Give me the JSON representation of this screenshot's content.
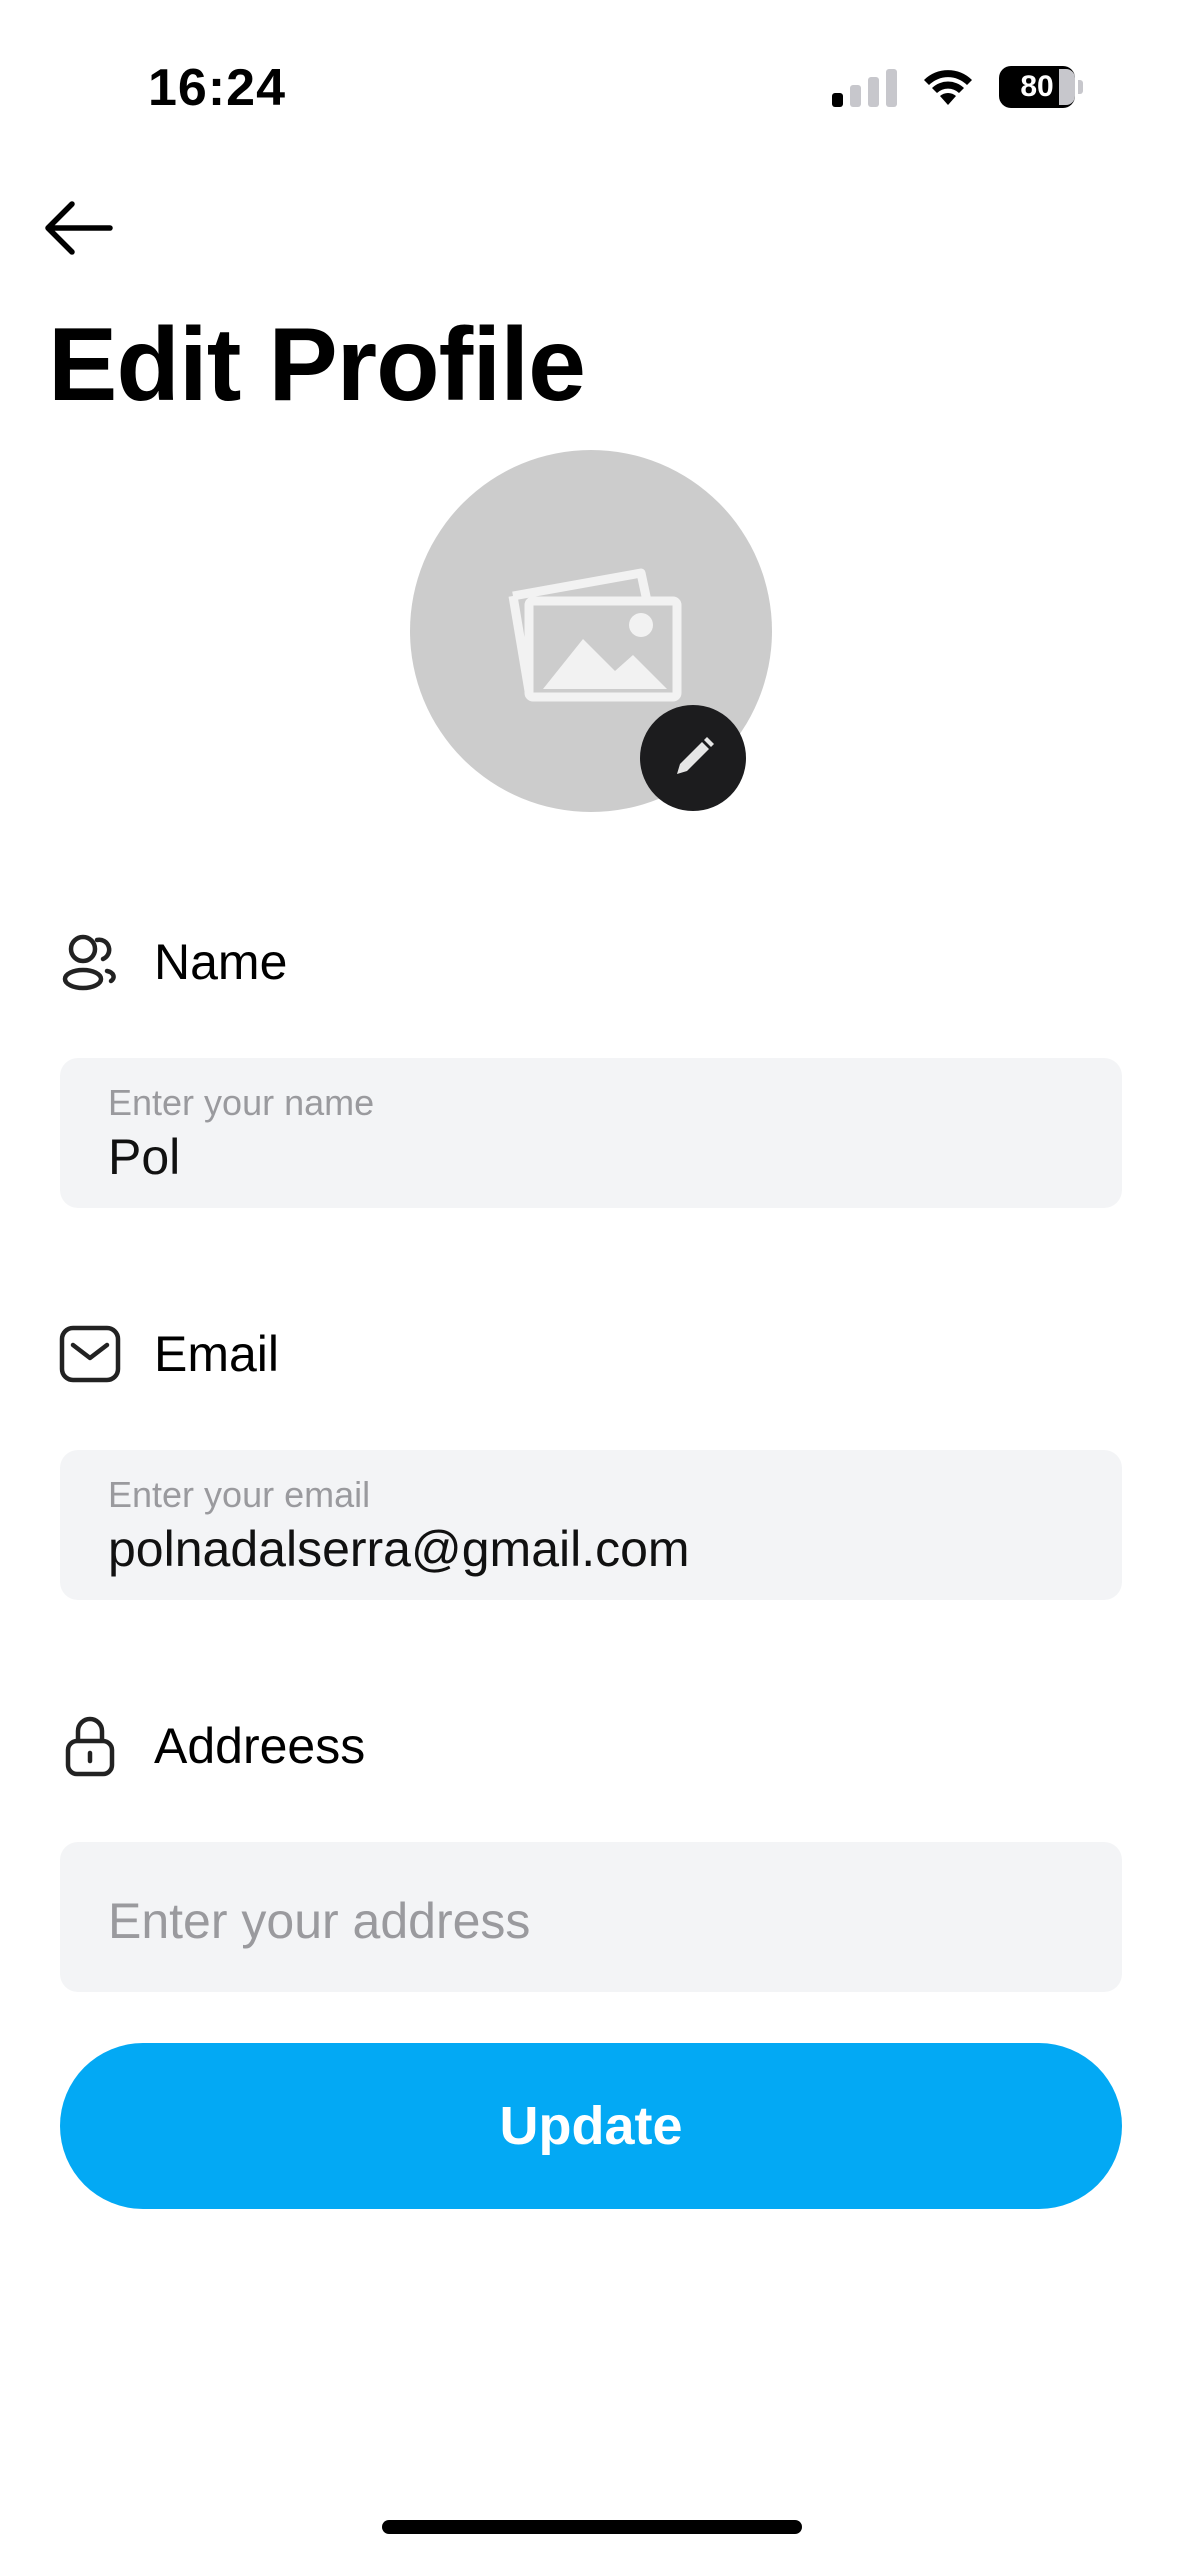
{
  "status_bar": {
    "time": "16:24",
    "battery": "80"
  },
  "header": {
    "title": "Edit Profile"
  },
  "form": {
    "name": {
      "label": "Name",
      "placeholder": "Enter your name",
      "value": "Pol"
    },
    "email": {
      "label": "Email",
      "placeholder": "Enter your email",
      "value": "polnadalserra@gmail.com"
    },
    "address": {
      "label": "Addreess",
      "placeholder": "Enter your address",
      "value": ""
    }
  },
  "actions": {
    "update_label": "Update"
  },
  "icons": {
    "back": "arrow-left-icon",
    "avatar_placeholder": "image-placeholder-icon",
    "edit": "pencil-icon",
    "name": "users-icon",
    "email": "mail-icon",
    "address": "lock-icon"
  },
  "colors": {
    "accent": "#03a9f4",
    "field_bg": "#f3f4f6",
    "avatar_bg": "#cccccc"
  }
}
